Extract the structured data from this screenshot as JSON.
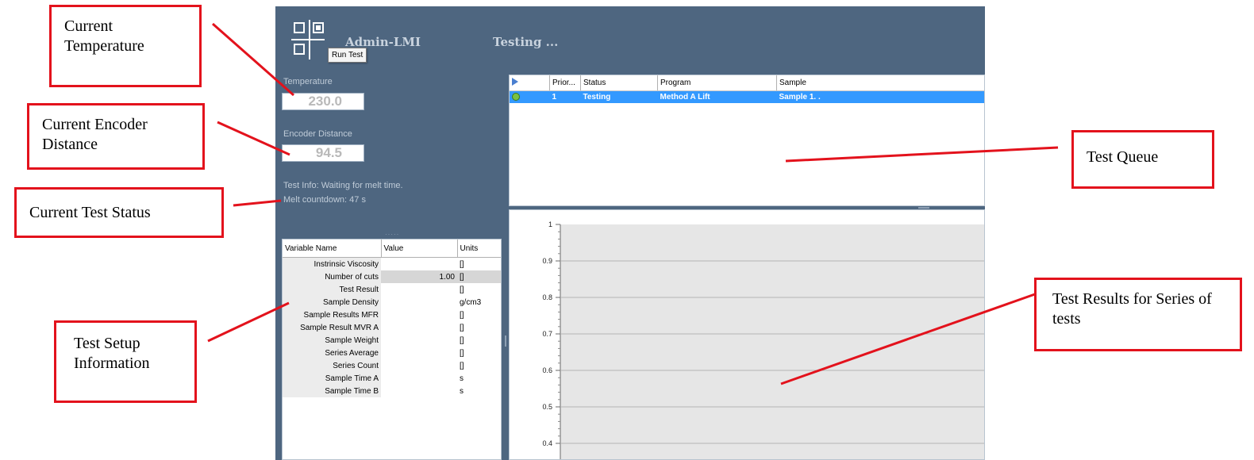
{
  "app": {
    "title": "Admin-LMI",
    "status_title": "Testing ...",
    "tooltip": "Run Test",
    "temperature": {
      "label": "Temperature",
      "value": "230.0"
    },
    "encoder": {
      "label": "Encoder Distance",
      "value": "94.5"
    },
    "test_info": "Test Info: Waiting for melt time.",
    "melt_countdown": "Melt countdown:   47 s"
  },
  "variables": {
    "headers": [
      "Variable Name",
      "Value",
      "Units"
    ],
    "rows": [
      {
        "name": "Instrinsic Viscosity",
        "value": "",
        "unit": "[]"
      },
      {
        "name": "Number of cuts",
        "value": "1.00",
        "unit": "[]"
      },
      {
        "name": "Test Result",
        "value": "",
        "unit": "[]"
      },
      {
        "name": "Sample Density",
        "value": "",
        "unit": "g/cm3"
      },
      {
        "name": "Sample Results MFR",
        "value": "",
        "unit": "[]"
      },
      {
        "name": "Sample Result MVR A",
        "value": "",
        "unit": "[]"
      },
      {
        "name": "Sample Weight",
        "value": "",
        "unit": "[]"
      },
      {
        "name": "Series Average",
        "value": "",
        "unit": "[]"
      },
      {
        "name": "Series Count",
        "value": "",
        "unit": "[]"
      },
      {
        "name": "Sample Time A",
        "value": "",
        "unit": "s"
      },
      {
        "name": "Sample Time B",
        "value": "",
        "unit": "s"
      }
    ]
  },
  "queue": {
    "headers": [
      "",
      "Prior...",
      "Status",
      "Program",
      "Sample"
    ],
    "rows": [
      {
        "priority": "1",
        "status": "Testing",
        "program": "Method A Lift",
        "sample": "Sample 1. ."
      }
    ]
  },
  "chart_data": {
    "type": "line",
    "y_ticks": [
      "1",
      "0.9",
      "0.8",
      "0.7",
      "0.6",
      "0.5",
      "0.4"
    ],
    "ylim": [
      0.4,
      1
    ],
    "grid": true,
    "series": []
  },
  "callouts": {
    "current_temperature": "Current Temperature",
    "current_encoder_distance": "Current Encoder Distance",
    "current_test_status": "Current Test Status",
    "test_setup_information": "Test Setup Information",
    "test_queue": "Test Queue",
    "test_results": "Test Results for Series of tests"
  },
  "colors": {
    "app_background": "#4e6680",
    "selection": "#3399ff",
    "callout_border": "#e3121c"
  }
}
